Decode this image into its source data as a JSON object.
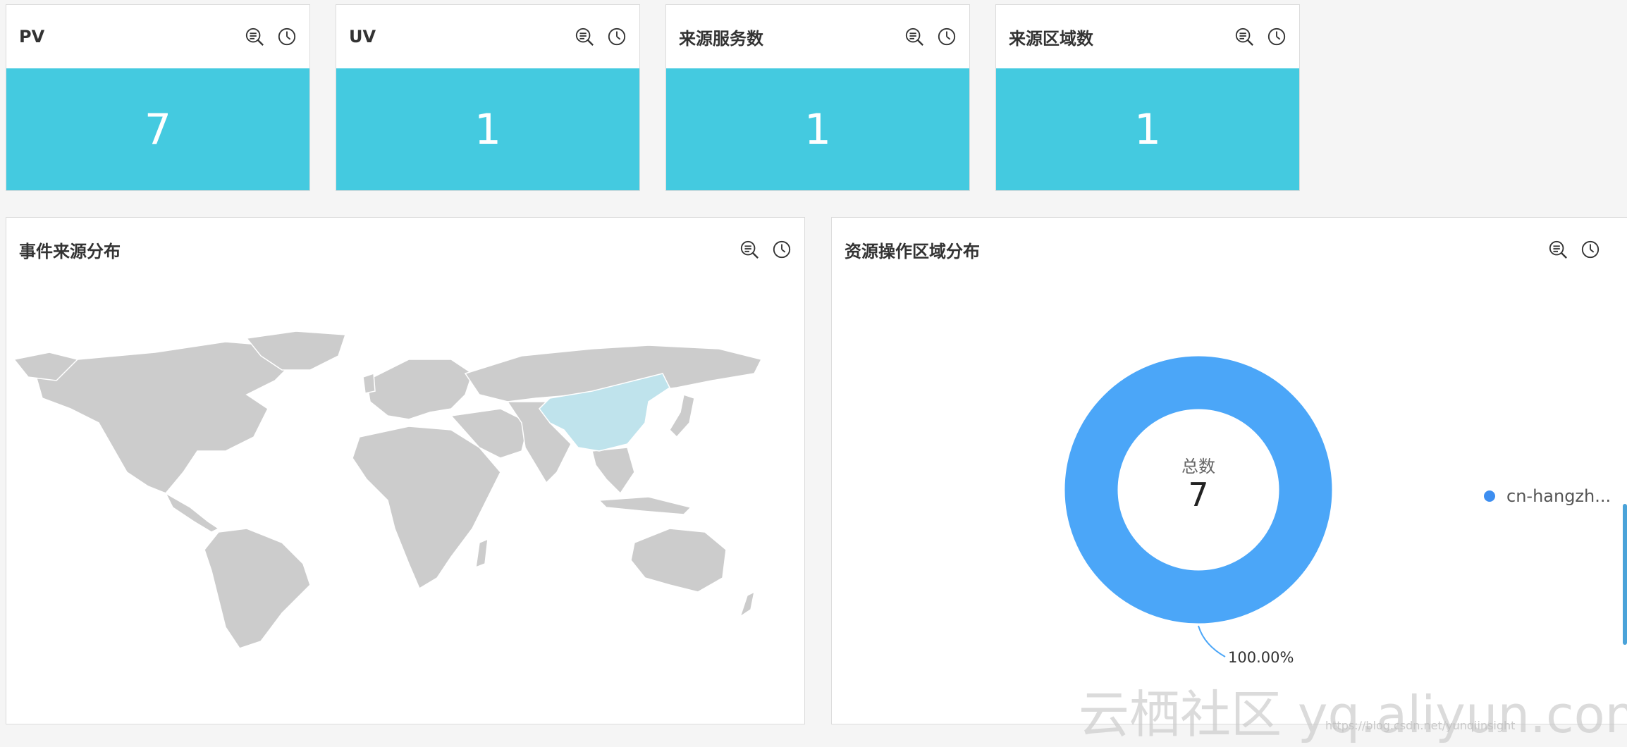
{
  "metrics": [
    {
      "title": "PV",
      "value": "7"
    },
    {
      "title": "UV",
      "value": "1"
    },
    {
      "title": "来源服务数",
      "value": "1"
    },
    {
      "title": "来源区域数",
      "value": "1"
    }
  ],
  "panels": {
    "map": {
      "title": "事件来源分布",
      "highlighted_region": "China"
    },
    "donut": {
      "title": "资源操作区域分布",
      "center_label": "总数",
      "center_value": "7",
      "slice_label": "100.00%",
      "legend": [
        {
          "name": "cn-hangzh...",
          "color": "#4ba6f8"
        }
      ]
    }
  },
  "chart_data": {
    "type": "pie",
    "labels": [
      "cn-hangzh..."
    ],
    "values": [
      7
    ],
    "percentages": [
      "100.00%"
    ],
    "donut": true,
    "center_text": "总数",
    "center_value": 7,
    "legend_position": "right"
  },
  "watermark": {
    "large": "云栖社区 yq.aliyun.com",
    "small": "https://blog.csdn.net/yunqiinsight"
  },
  "colors": {
    "metric_fill": "#44cae0",
    "donut_fill": "#4ba6f8",
    "map_land": "#cccccc",
    "map_highlight": "#bfe3ec"
  },
  "icons": {
    "search": "list-search-icon",
    "history": "clock-icon"
  }
}
